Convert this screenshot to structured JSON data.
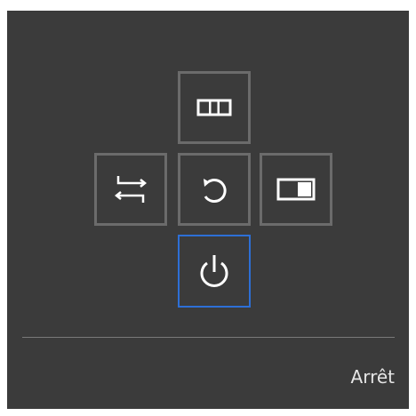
{
  "menu": {
    "selected_label": "Arrêt",
    "selected_item": "power",
    "items": [
      {
        "id": "picture-mode",
        "icon": "picture-columns-icon"
      },
      {
        "id": "source",
        "icon": "source-switch-icon"
      },
      {
        "id": "return",
        "icon": "return-icon"
      },
      {
        "id": "picture-in-picture",
        "icon": "pip-icon"
      },
      {
        "id": "power",
        "icon": "power-icon"
      }
    ]
  },
  "colors": {
    "background": "#3b3b3b",
    "button_border": "#6b6b6b",
    "selected_border": "#2d6fd6",
    "icon": "#ffffff",
    "divider": "#7a7a7a",
    "text": "#e6e6e6"
  }
}
